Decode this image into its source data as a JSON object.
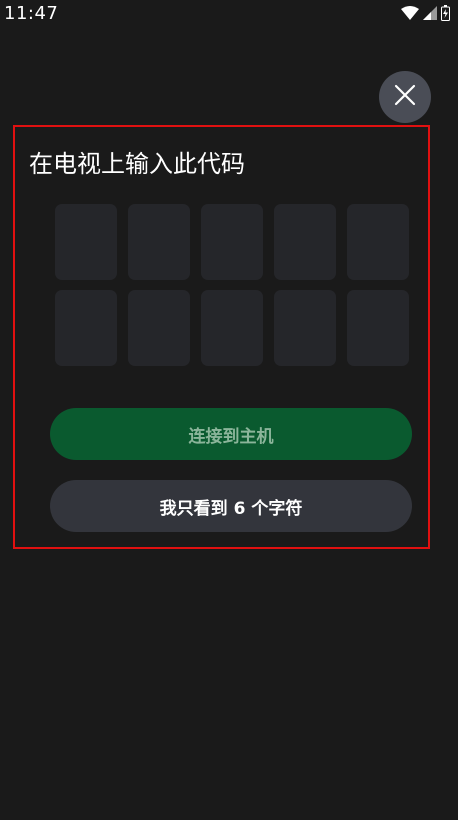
{
  "status_bar": {
    "time": "11:47",
    "icons": [
      "wifi-icon",
      "signal-icon",
      "battery-icon"
    ]
  },
  "close_button": {
    "icon": "close-icon"
  },
  "dialog": {
    "title": "在电视上输入此代码",
    "code_cells": [
      "",
      "",
      "",
      "",
      "",
      "",
      "",
      "",
      "",
      ""
    ],
    "connect_button_label": "连接到主机",
    "six_chars_button_label": "我只看到 6 个字符"
  },
  "colors": {
    "background": "#1a1a1a",
    "highlight_border": "#e01010",
    "code_cell": "#25262a",
    "connect_button": "#0a5a2f",
    "connect_button_text": "#8bb59a",
    "secondary_button": "#33353c",
    "close_button": "#4a4d56"
  }
}
